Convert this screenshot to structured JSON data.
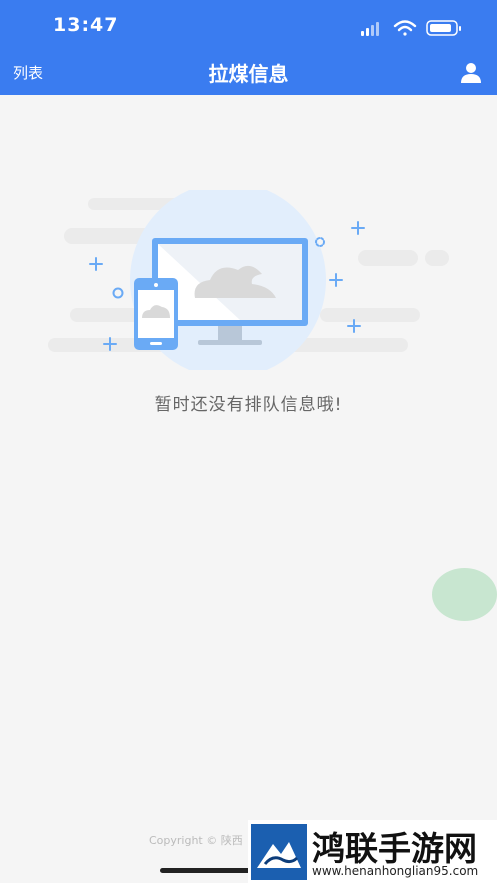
{
  "status_bar": {
    "time": "13:47"
  },
  "nav": {
    "left_label": "列表",
    "title": "拉煤信息",
    "right_icon": "user-icon"
  },
  "empty_state": {
    "message": "暂时还没有排队信息哦!",
    "illustration": "monitor-phone-cloud-illustration"
  },
  "footer": {
    "copyright": "Copyright © 陕西"
  },
  "watermark": {
    "title": "鸿联手游网",
    "url": "www.henanhonglian95.com"
  },
  "colors": {
    "header": "#3a7cf0",
    "background": "#f5f5f5",
    "float_ball": "#c8e6d0",
    "accent": "#6aaaf5"
  }
}
